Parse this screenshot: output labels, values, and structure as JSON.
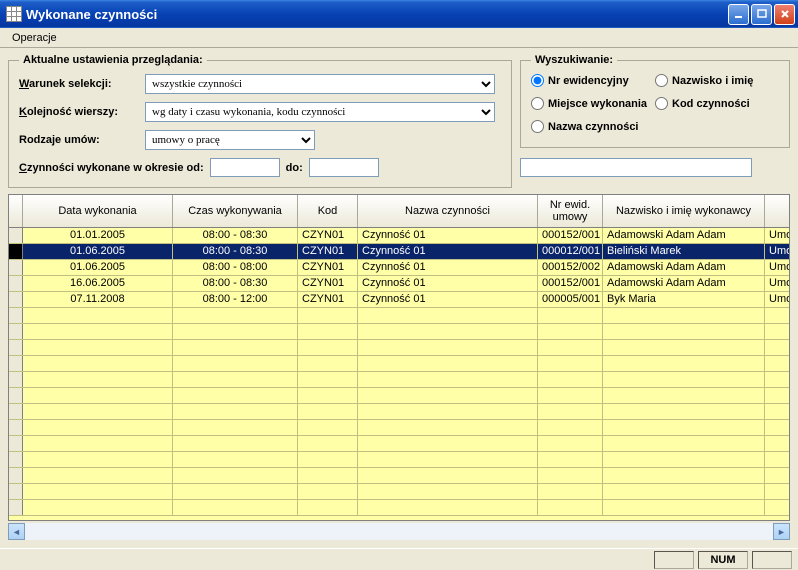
{
  "window": {
    "title": "Wykonane czynności"
  },
  "menu": {
    "operacje": "Operacje"
  },
  "settings": {
    "legend": "Aktualne ustawienia przeglądania:",
    "warunek_label": "Warunek selekcji:",
    "warunek_value": "wszystkie czynności",
    "kolejnosc_label": "Kolejność wierszy:",
    "kolejnosc_value": "wg daty i czasu wykonania, kodu czynności",
    "rodzaje_label": "Rodzaje umów:",
    "rodzaje_value": "umowy o pracę",
    "okres_label": "Czynności wykonane w okresie od:",
    "okres_do": "do:",
    "okres_from": "",
    "okres_to": ""
  },
  "search": {
    "legend": "Wyszukiwanie:",
    "options": {
      "nrewid": "Nr ewidencyjny",
      "nazwisko": "Nazwisko i imię",
      "miejsce": "Miejsce wykonania",
      "kod": "Kod czynności",
      "nazwa": "Nazwa czynności"
    },
    "selected": "nrewid",
    "value": ""
  },
  "grid": {
    "headers": {
      "data": "Data wykonania",
      "czas": "Czas wykonywania",
      "kod": "Kod",
      "nazwa": "Nazwa czynności",
      "nr": "Nr ewid. umowy",
      "person": "Nazwisko i imię wykonawcy"
    },
    "rows": [
      {
        "data": "01.01.2005",
        "czas": "08:00 - 08:30",
        "kod": "CZYN01",
        "nazwa": "Czynność 01",
        "nr": "000152/001",
        "person": "Adamowski Adam Adam",
        "last": "Umow",
        "selected": false
      },
      {
        "data": "01.06.2005",
        "czas": "08:00 - 08:30",
        "kod": "CZYN01",
        "nazwa": "Czynność 01",
        "nr": "000012/001",
        "person": "Bieliński Marek",
        "last": "Umow",
        "selected": true
      },
      {
        "data": "01.06.2005",
        "czas": "08:00 - 08:00",
        "kod": "CZYN01",
        "nazwa": "Czynność 01",
        "nr": "000152/002",
        "person": "Adamowski Adam Adam",
        "last": "Umow",
        "selected": false
      },
      {
        "data": "16.06.2005",
        "czas": "08:00 - 08:30",
        "kod": "CZYN01",
        "nazwa": "Czynność 01",
        "nr": "000152/001",
        "person": "Adamowski Adam Adam",
        "last": "Umow",
        "selected": false
      },
      {
        "data": "07.11.2008",
        "czas": "08:00 - 12:00",
        "kod": "CZYN01",
        "nazwa": "Czynność 01",
        "nr": "000005/001",
        "person": "Byk Maria",
        "last": "Umow",
        "selected": false
      }
    ]
  },
  "status": {
    "num": "NUM"
  }
}
